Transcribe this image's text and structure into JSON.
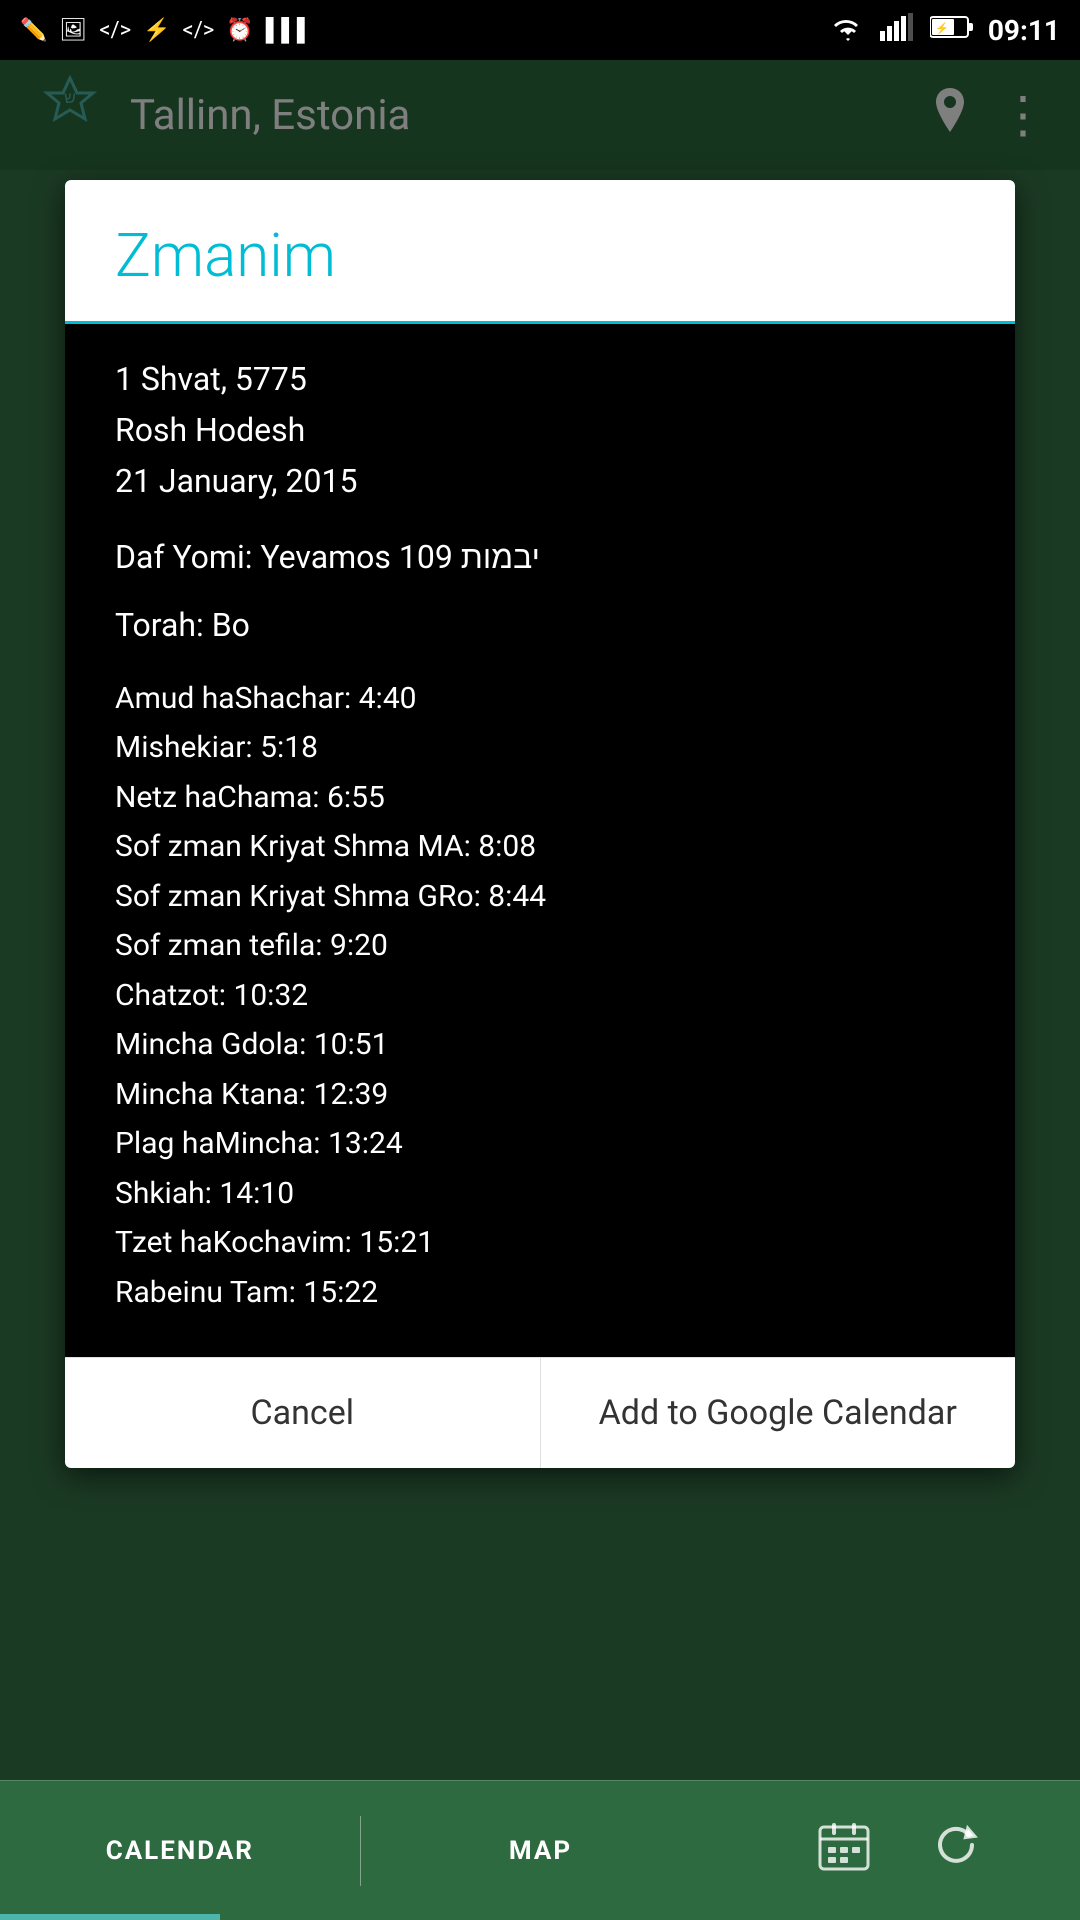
{
  "statusBar": {
    "time": "09:11",
    "icons_left": [
      "edit-icon",
      "image-icon",
      "code-icon",
      "usb-icon",
      "code2-icon",
      "clock-icon",
      "barcode-icon"
    ],
    "icons_right": [
      "wifi-icon",
      "signal-icon",
      "battery-icon"
    ]
  },
  "header": {
    "logo_letter": "ש",
    "title": "Tallinn, Estonia",
    "location_icon": "location-icon",
    "menu_icon": "more-icon"
  },
  "dialog": {
    "title": "Zmanim",
    "date_hebrew": "1 Shvat, 5775",
    "date_special": "Rosh Hodesh",
    "date_gregorian": "21 January, 2015",
    "daf_yomi": "Daf Yomi: Yevamos 109 יבמות",
    "torah": "Torah: Bo",
    "zmanim": [
      "Amud haShachar: 4:40",
      "Mishekiar: 5:18",
      "Netz haChama: 6:55",
      "Sof zman Kriyat Shma MA: 8:08",
      "Sof zman Kriyat Shma GRo: 8:44",
      "Sof zman tefila: 9:20",
      "Chatzot: 10:32",
      "Mincha Gdola: 10:51",
      "Mincha Ktana: 12:39",
      "Plag haMincha: 13:24",
      "Shkiah: 14:10",
      "Tzet haKochavim: 15:21",
      "Rabeinu Tam: 15:22"
    ],
    "cancel_label": "Cancel",
    "add_calendar_label": "Add to Google Calendar"
  },
  "bottomNav": {
    "calendar_label": "CALENDAR",
    "map_label": "MAP",
    "calendar_icon": "calendar-icon",
    "refresh_icon": "refresh-icon"
  }
}
